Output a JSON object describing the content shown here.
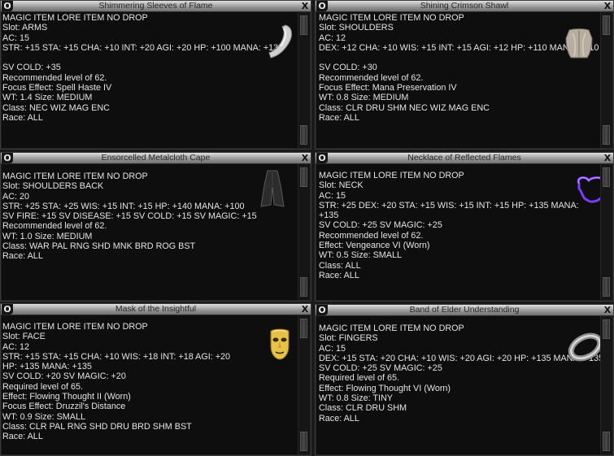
{
  "windows": [
    {
      "title": "Shimmering Sleeves of Flame",
      "lines": [
        "MAGIC ITEM LORE ITEM NO DROP",
        "Slot: ARMS",
        "AC: 15",
        "STR: +15 STA: +15 CHA: +10 INT: +20 AGI: +20 HP: +100 MANA: +135",
        "",
        "SV COLD: +35",
        "Recommended level of 62.",
        "Focus Effect: Spell Haste IV",
        "WT: 1.4 Size: MEDIUM",
        "Class: NEC WIZ MAG ENC",
        "Race: ALL"
      ],
      "icon": "sleeves-icon"
    },
    {
      "title": "Shining Crimson Shawl",
      "lines": [
        "MAGIC ITEM LORE ITEM NO DROP",
        "Slot: SHOULDERS",
        "AC: 12",
        "DEX: +12 CHA: +10 WIS: +15 INT: +15 AGI: +12 HP: +110 MANA: +110",
        "",
        "SV COLD: +30",
        "Recommended level of 62.",
        "Focus Effect: Mana Preservation IV",
        "WT: 0.8 Size: MEDIUM",
        "Class: CLR DRU SHM NEC WIZ MAG ENC",
        "Race: ALL"
      ],
      "icon": "shawl-icon"
    },
    {
      "title": "Ensorcelled Metalcloth Cape",
      "lines": [
        "MAGIC ITEM LORE ITEM NO DROP",
        "Slot: SHOULDERS BACK",
        "AC: 20",
        "STR: +25 STA: +25 WIS: +15 INT: +15 HP: +140 MANA: +100",
        "SV FIRE: +15 SV DISEASE: +15 SV COLD: +15 SV MAGIC: +15",
        "Recommended level of 62.",
        "WT: 1.0 Size: MEDIUM",
        "Class: WAR PAL RNG SHD MNK BRD ROG BST",
        "Race: ALL"
      ],
      "icon": "cape-icon"
    },
    {
      "title": "Necklace of Reflected Flames",
      "lines": [
        "MAGIC ITEM LORE ITEM NO DROP",
        "Slot: NECK",
        "AC: 15",
        "STR: +25 DEX: +20 STA: +15 WIS: +15 INT: +15 HP: +135 MANA:",
        "+135",
        "SV COLD: +25 SV MAGIC: +25",
        "Recommended level of 62.",
        "Effect: Vengeance VI (Worn)",
        "WT: 0.5 Size: SMALL",
        "Class: ALL",
        "Race: ALL"
      ],
      "icon": "necklace-icon"
    },
    {
      "title": "Mask of the Insightful",
      "lines": [
        "MAGIC ITEM LORE ITEM NO DROP",
        "Slot: FACE",
        "AC: 12",
        "STR: +15 STA: +15 CHA: +10 WIS: +18 INT: +18 AGI: +20",
        "HP: +135 MANA: +135",
        "SV COLD: +20 SV MAGIC: +20",
        "Required level of 65.",
        "Effect: Flowing Thought II (Worn)",
        "Focus Effect: Druzzil's Distance",
        "WT: 0.9 Size: SMALL",
        "Class: CLR PAL RNG SHD DRU BRD SHM BST",
        "Race: ALL"
      ],
      "icon": "mask-icon"
    },
    {
      "title": "Band of Elder Understanding",
      "lines": [
        "MAGIC ITEM LORE ITEM NO DROP",
        "Slot: FINGERS",
        "AC: 15",
        "DEX: +15 STA: +20 CHA: +10 WIS: +20 AGI: +20 HP: +135 MANA: +135",
        "SV COLD: +25 SV MAGIC: +25",
        "Required level of 65.",
        "Effect: Flowing Thought VI (Worn)",
        "WT: 0.8 Size: TINY",
        "Class: CLR DRU SHM",
        "Race: ALL"
      ],
      "icon": "ring-icon"
    }
  ],
  "buttons": {
    "options": "O",
    "close": "X"
  }
}
